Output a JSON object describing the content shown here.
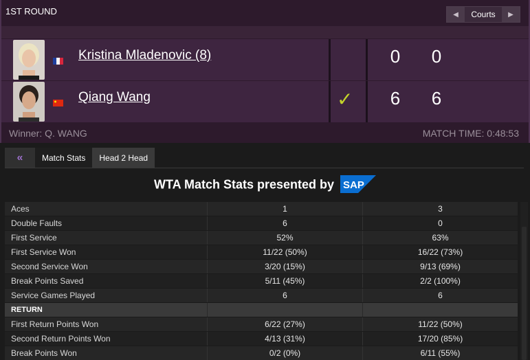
{
  "header": {
    "round": "1ST ROUND",
    "courts_label": "Courts"
  },
  "players": [
    {
      "name": "Kristina Mladenovic (8)",
      "flag": "france",
      "winner": false,
      "sets": [
        "0",
        "0"
      ]
    },
    {
      "name": "Qiang Wang",
      "flag": "china",
      "winner": true,
      "sets": [
        "6",
        "6"
      ]
    }
  ],
  "winner_text": "Winner: Q. WANG",
  "match_time": "MATCH TIME: 0:48:53",
  "tabs": {
    "back_icon": "«",
    "match_stats": "Match Stats",
    "head2head": "Head 2 Head"
  },
  "stats_title": "WTA Match Stats presented by",
  "sponsor_logo_text": "SAP",
  "stats": [
    {
      "label": "Aces",
      "p1": "1",
      "p2": "3"
    },
    {
      "label": "Double Faults",
      "p1": "6",
      "p2": "0"
    },
    {
      "label": "First Service",
      "p1": "52%",
      "p2": "63%"
    },
    {
      "label": "First Service Won",
      "p1": "11/22 (50%)",
      "p2": "16/22 (73%)"
    },
    {
      "label": "Second Service Won",
      "p1": "3/20 (15%)",
      "p2": "9/13 (69%)"
    },
    {
      "label": "Break Points Saved",
      "p1": "5/11 (45%)",
      "p2": "2/2 (100%)"
    },
    {
      "label": "Service Games Played",
      "p1": "6",
      "p2": "6"
    },
    {
      "label": "RETURN",
      "p1": "",
      "p2": "",
      "section": true
    },
    {
      "label": "First Return Points Won",
      "p1": "6/22 (27%)",
      "p2": "11/22 (50%)"
    },
    {
      "label": "Second Return Points Won",
      "p1": "4/13 (31%)",
      "p2": "17/20 (85%)"
    },
    {
      "label": "Break Points Won",
      "p1": "0/2 (0%)",
      "p2": "6/11 (55%)"
    }
  ],
  "colors": {
    "header_bg": "#2d1a2c",
    "row_bg": "#3e2540",
    "check": "#c4d42a",
    "sap_blue": "#0a6ed1"
  }
}
